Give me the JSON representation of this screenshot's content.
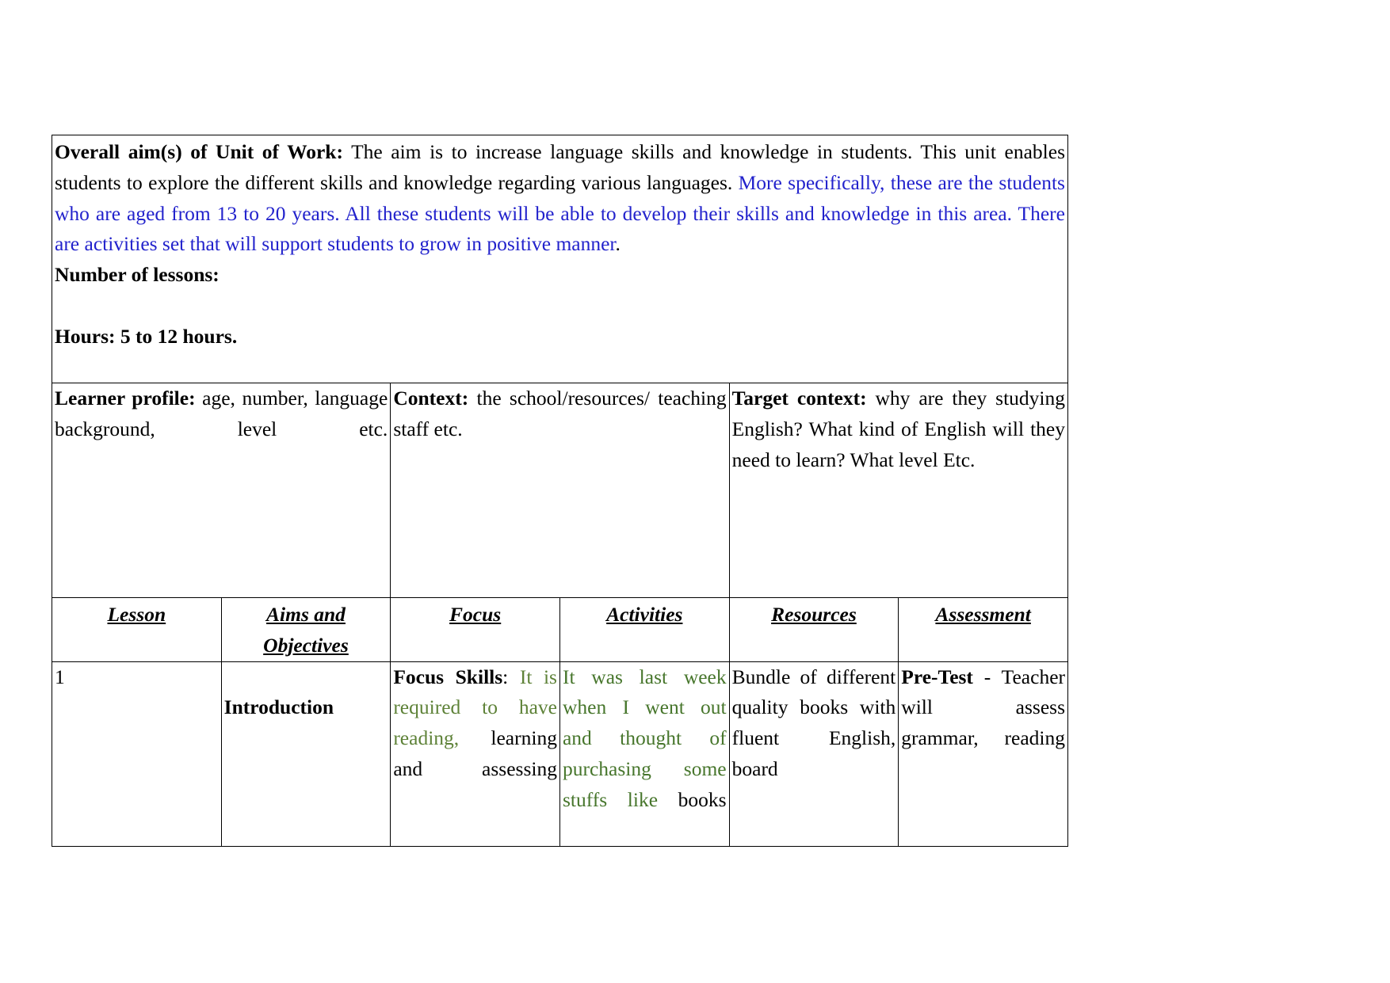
{
  "document": {
    "type": "lesson-plan-table",
    "colors": {
      "text": "#000000",
      "inserted_blue": "#2222cc",
      "inserted_green": "#5e8238",
      "border": "#000000"
    },
    "aims": {
      "heading": "Overall aim(s) of Unit of Work:",
      "text_black_1": " The aim is to increase language skills and knowledge in students. This unit enables students to explore the different skills and knowledge regarding various languages. ",
      "text_blue": "More specifically, these are the students who are aged from 13 to 20 years. All these students will be able to develop their skills and knowledge in this area. There are activities set that will support students to grow in positive manner",
      "text_black_2": ".",
      "number_of_lessons_label": "Number of lessons:",
      "hours_label": "Hours: 5 to 12 hours."
    },
    "profile_row": {
      "learner_profile": {
        "heading": "Learner profile:",
        "text": " age, number, language background, level etc."
      },
      "context": {
        "heading": "Context:",
        "text": " the school/resources/ teaching staff etc."
      },
      "target_context": {
        "heading": "Target context:",
        "text": " why are they studying English? What kind of English will they need to learn? What level Etc."
      }
    },
    "table": {
      "headers": [
        "Lesson",
        "Aims and Objectives",
        "Focus",
        "Activities",
        "Resources",
        "Assessment"
      ],
      "headers_split": {
        "aims_line1": "Aims and",
        "aims_line2": "Objectives"
      },
      "rows": [
        {
          "lesson": "1",
          "aims_objectives": "Introduction",
          "focus": {
            "label": "Focus Skills",
            "colon": ":",
            "green_1": " It is required to have reading,",
            "black_1": " learning and assessing"
          },
          "activities": {
            "green_1": "It was last week when I went out and thought of purchasing some stuffs like",
            "black_1": " books"
          },
          "resources": "Bundle of different quality books with fluent English, board",
          "assessment": {
            "bold_label": "Pre-Test",
            "text": " - Teacher will assess grammar, reading"
          }
        }
      ]
    }
  }
}
